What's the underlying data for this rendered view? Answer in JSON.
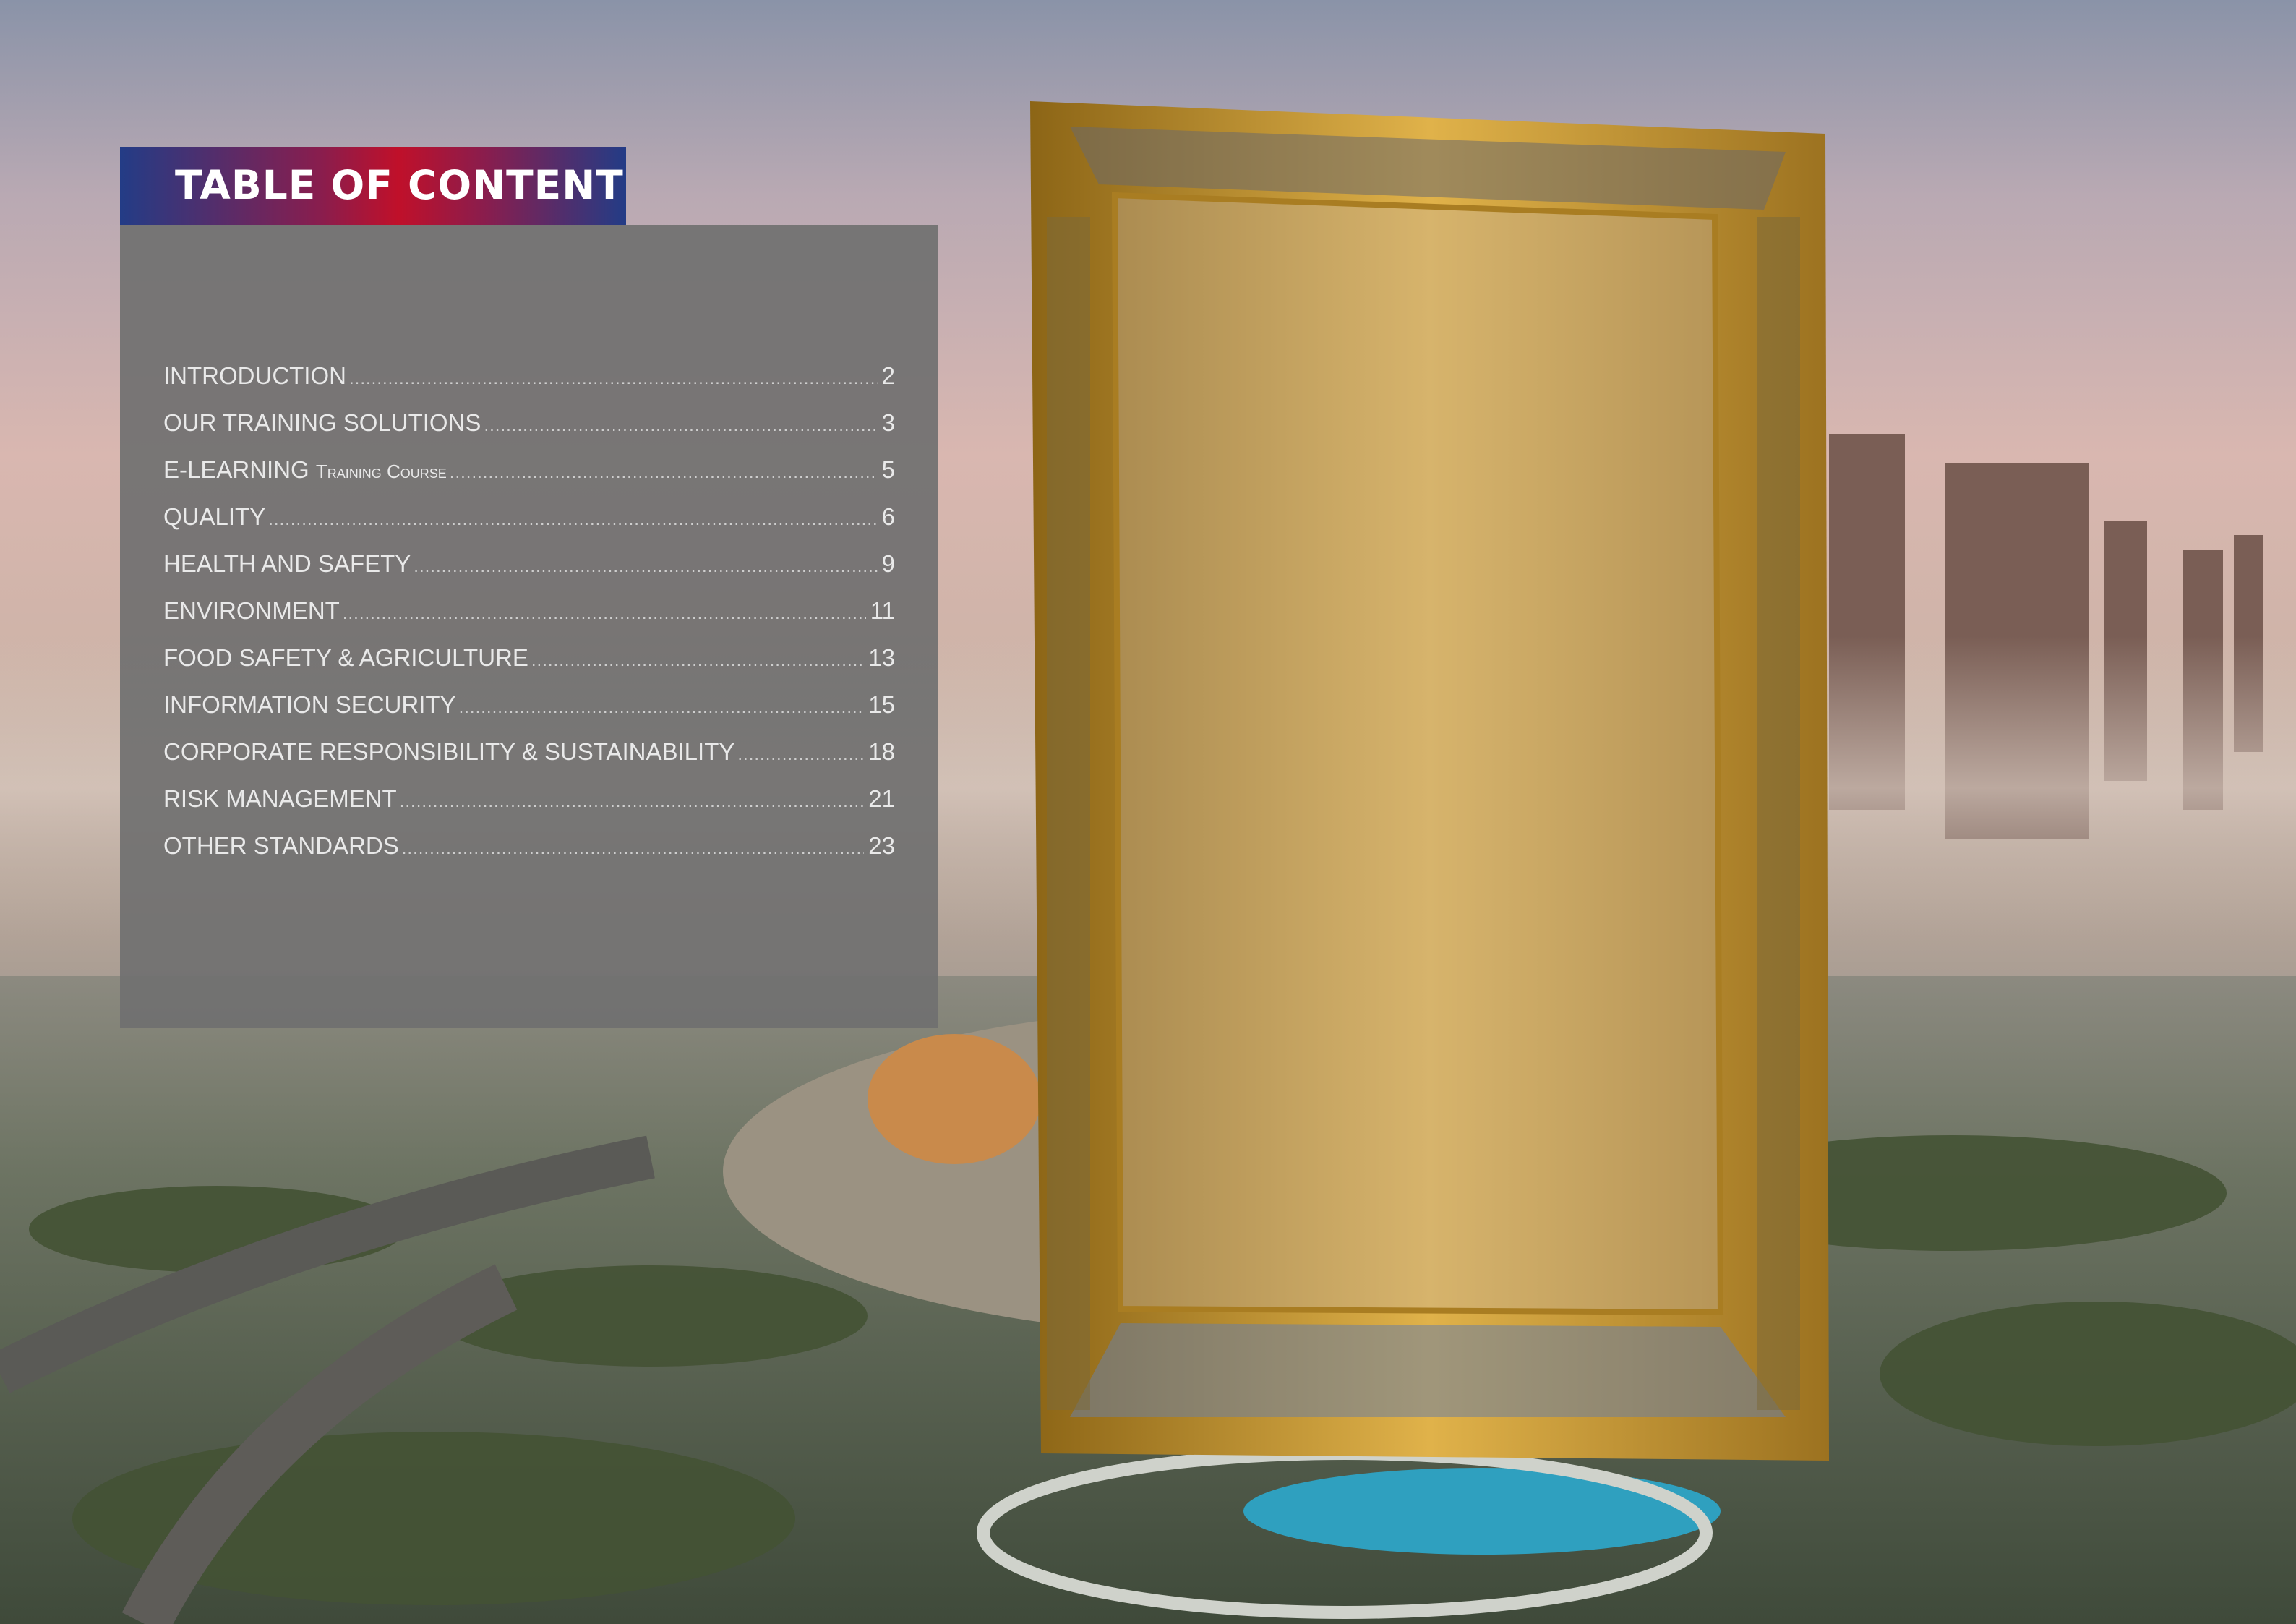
{
  "toc": {
    "title": "TABLE OF CONTENT",
    "entries": [
      {
        "label": "INTRODUCTION",
        "page": "2"
      },
      {
        "label": "OUR TRAINING SOLUTIONS",
        "page": "3"
      },
      {
        "label": "E-LEARNING ",
        "label_sc": "Training Course",
        "page": "5"
      },
      {
        "label": "QUALITY",
        "page": "6"
      },
      {
        "label": "HEALTH AND SAFETY",
        "page": "9"
      },
      {
        "label": "ENVIRONMENT",
        "page": "11"
      },
      {
        "label": "FOOD SAFETY & AGRICULTURE",
        "page": "13"
      },
      {
        "label": "INFORMATION SECURITY",
        "page": "15"
      },
      {
        "label": "CORPORATE RESPONSIBILITY & SUSTAINABILITY",
        "page": "18"
      },
      {
        "label": "RISK MANAGEMENT",
        "page": "21"
      },
      {
        "label": "OTHER STANDARDS",
        "page": "23"
      }
    ]
  },
  "colors": {
    "header_blue": "#233c86",
    "header_red": "#c0102a",
    "panel_grey": "#707070",
    "frame_gold": "#c99a2e"
  }
}
